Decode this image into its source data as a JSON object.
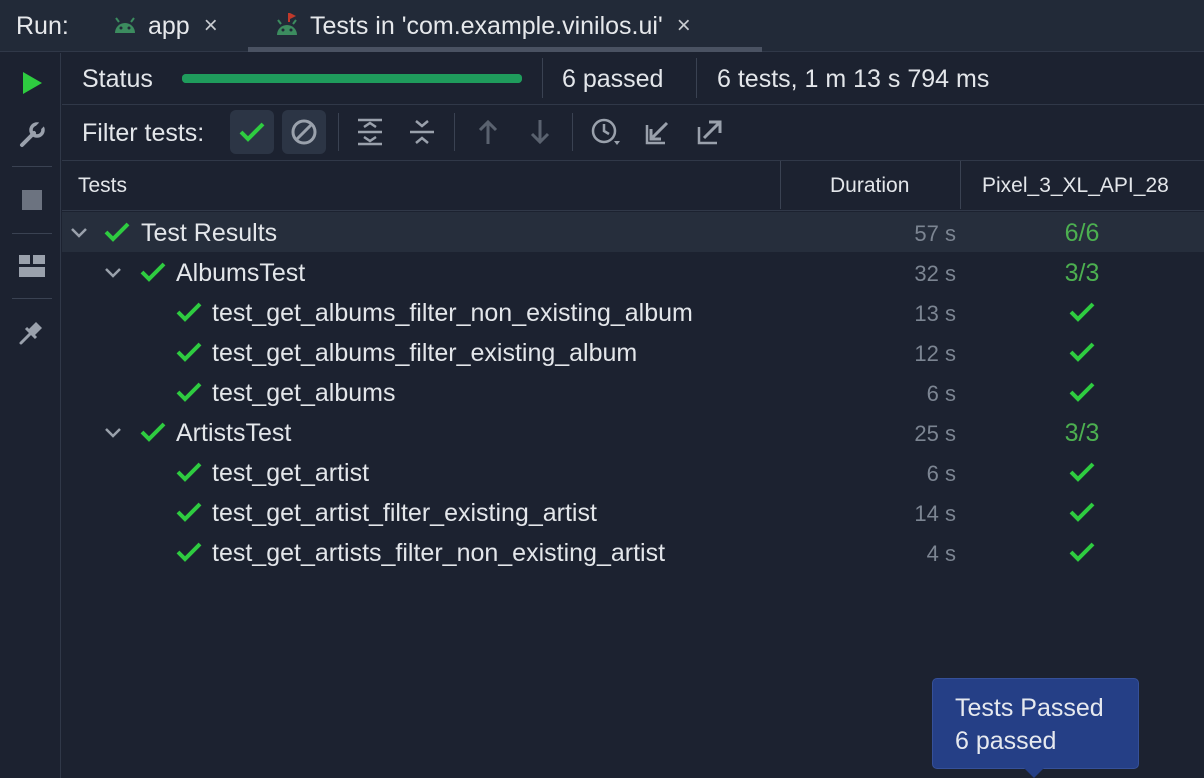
{
  "runbar": {
    "label": "Run:",
    "tabs": [
      {
        "icon": "android-icon",
        "label": "app",
        "close": "×"
      },
      {
        "icon": "android-test-icon",
        "label": "Tests in 'com.example.vinilos.ui'",
        "close": "×"
      }
    ]
  },
  "toolbar": {
    "tools": [
      "run-icon",
      "wrench-icon",
      "stop-icon",
      "layout-icon",
      "pin-icon"
    ]
  },
  "status": {
    "label": "Status",
    "progress": 1.0,
    "passed": "6 passed",
    "summary": "6 tests, 1 m 13 s 794 ms"
  },
  "filter": {
    "label": "Filter tests:",
    "buttons": [
      "show-passed-icon",
      "show-ignored-icon",
      "expand-all-icon",
      "collapse-all-icon",
      "previous-failed-icon",
      "next-failed-icon",
      "history-icon",
      "import-tests-icon",
      "export-tests-icon"
    ]
  },
  "table": {
    "headers": {
      "tests": "Tests",
      "duration": "Duration",
      "device": "Pixel_3_XL_API_28"
    },
    "rows": [
      {
        "name": "Test Results",
        "duration": "57 s",
        "result": "6/6"
      },
      {
        "name": "AlbumsTest",
        "duration": "32 s",
        "result": "3/3"
      },
      {
        "name": "test_get_albums_filter_non_existing_album",
        "duration": "13 s",
        "result": "✓"
      },
      {
        "name": "test_get_albums_filter_existing_album",
        "duration": "12 s",
        "result": "✓"
      },
      {
        "name": "test_get_albums",
        "duration": "6 s",
        "result": "✓"
      },
      {
        "name": "ArtistsTest",
        "duration": "25 s",
        "result": "3/3"
      },
      {
        "name": "test_get_artist",
        "duration": "6 s",
        "result": "✓"
      },
      {
        "name": "test_get_artist_filter_existing_artist",
        "duration": "14 s",
        "result": "✓"
      },
      {
        "name": "test_get_artists_filter_non_existing_artist",
        "duration": "4 s",
        "result": "✓"
      }
    ]
  },
  "tooltip": {
    "title": "Tests Passed",
    "body": "6 passed"
  },
  "colors": {
    "pass": "#2ecc40",
    "progress": "#1f9c5c",
    "count": "#4caf50"
  }
}
